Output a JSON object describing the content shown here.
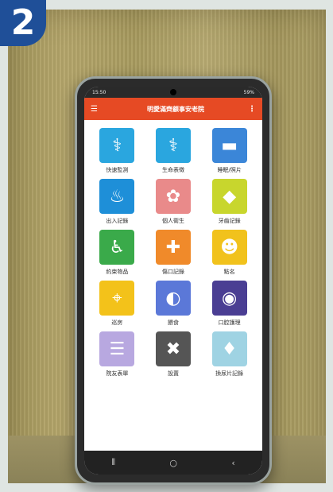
{
  "badge": {
    "number": "2"
  },
  "status": {
    "time": "15:50",
    "right": "59%"
  },
  "appbar": {
    "title": "明愛滿齊顧事安老院",
    "menu_icon": "☰",
    "more_icon": "⋮"
  },
  "tiles": [
    {
      "label": "快速監測",
      "color": "#2aa6df",
      "icon": "⚕"
    },
    {
      "label": "生命表徵",
      "color": "#2aa6df",
      "icon": "⚕"
    },
    {
      "label": "睡眠/照片",
      "color": "#3b86d8",
      "icon": "▬"
    },
    {
      "label": "出入記錄",
      "color": "#1e8fd8",
      "icon": "♨"
    },
    {
      "label": "個人衛生",
      "color": "#e98a8a",
      "icon": "✿"
    },
    {
      "label": "牙齒記錄",
      "color": "#c8d62d",
      "icon": "◆"
    },
    {
      "label": "約束物品",
      "color": "#3aaa4a",
      "icon": "♿"
    },
    {
      "label": "傷口記錄",
      "color": "#f08a2a",
      "icon": "✚"
    },
    {
      "label": "點名",
      "color": "#f1c21c",
      "icon": "☻"
    },
    {
      "label": "巡房",
      "color": "#f3c21a",
      "icon": "⌖"
    },
    {
      "label": "餵食",
      "color": "#5b78d8",
      "icon": "◐"
    },
    {
      "label": "口腔護理",
      "color": "#4a3e93",
      "icon": "◉"
    },
    {
      "label": "院友表單",
      "color": "#b8a8e0",
      "icon": "☰"
    },
    {
      "label": "設置",
      "color": "#555555",
      "icon": "✖"
    },
    {
      "label": "換尿片記錄",
      "color": "#9fd3e3",
      "icon": "♦"
    }
  ],
  "navbar": {
    "recent": "⦀",
    "home": "○",
    "back": "‹"
  }
}
